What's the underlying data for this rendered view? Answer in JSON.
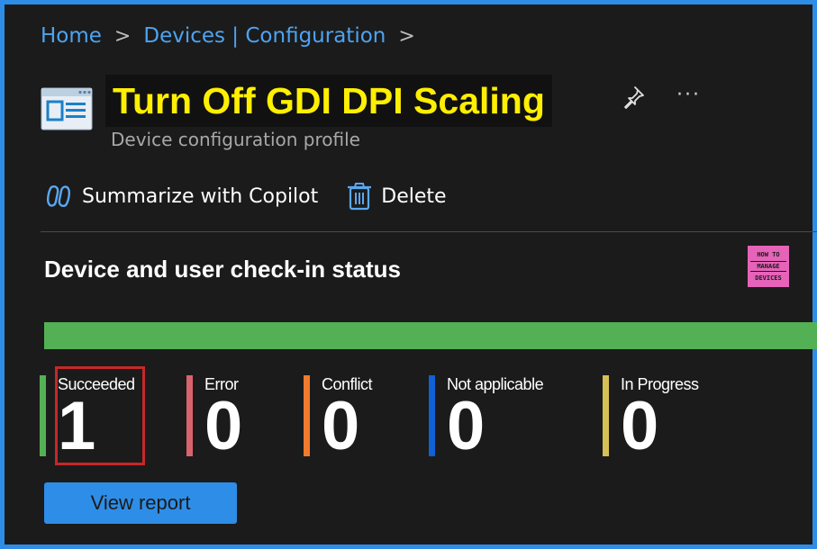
{
  "breadcrumb": {
    "items": [
      "Home",
      "Devices | Configuration"
    ],
    "separator": ">"
  },
  "header": {
    "title": "Turn Off GDI DPI Scaling",
    "subtitle": "Device configuration profile",
    "more_label": "···",
    "title_color": "#ffef00",
    "icons": [
      "config-profile-icon",
      "pin-icon",
      "more-icon"
    ]
  },
  "toolbar": {
    "copilot_label": "Summarize with Copilot",
    "delete_label": "Delete",
    "icons": [
      "copilot-icon",
      "trash-icon"
    ]
  },
  "status": {
    "title": "Device and user check-in status",
    "progress_fraction": 1.0,
    "items": [
      {
        "label": "Succeeded",
        "value": "1",
        "color": "#54b054"
      },
      {
        "label": "Error",
        "value": "0",
        "color": "#d9636d"
      },
      {
        "label": "Conflict",
        "value": "0",
        "color": "#f07b2e"
      },
      {
        "label": "Not applicable",
        "value": "0",
        "color": "#1060d6"
      },
      {
        "label": "In Progress",
        "value": "0",
        "color": "#d6bf55"
      }
    ],
    "view_report_label": "View report"
  },
  "logo": {
    "line1": "HOW TO",
    "line2": "MANAGE",
    "line3": "DEVICES"
  },
  "colors": {
    "accent": "#2e8de6",
    "link": "#4ea3f0",
    "highlight": "#c62828"
  }
}
